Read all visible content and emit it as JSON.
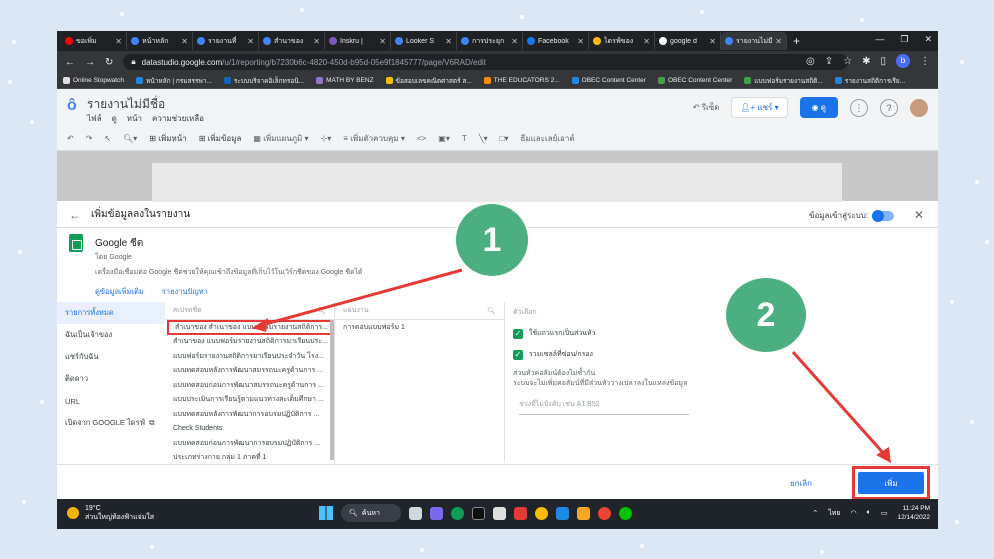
{
  "browser": {
    "tabs": [
      {
        "label": "ขอเพิ่ม",
        "color": "#ff0000",
        "active": false
      },
      {
        "label": "หน้าหลัก",
        "color": "#4285f4",
        "active": false
      },
      {
        "label": "รายงานที่",
        "color": "#4285f4",
        "active": false
      },
      {
        "label": "สำนาของ",
        "color": "#4285f4",
        "active": false
      },
      {
        "label": "Inskru |",
        "color": "#7e57c2",
        "active": false
      },
      {
        "label": "Looker S",
        "color": "#4285f4",
        "active": false
      },
      {
        "label": "การประยุก",
        "color": "#4285f4",
        "active": false
      },
      {
        "label": "Facebook",
        "color": "#1877f2",
        "active": false
      },
      {
        "label": "ไดรฟ์ของ",
        "color": "#fbbc04",
        "active": false
      },
      {
        "label": "google d",
        "color": "#ffffff",
        "active": false
      },
      {
        "label": "รายงานไม่มี",
        "color": "#4285f4",
        "active": true
      }
    ],
    "new_tab": "+",
    "url_host": "datastudio.google.com",
    "url_path": "/u/1/reporting/b7230b6c-4820-450d-b95d-05e9f1845777/page/V6RAD/edit",
    "profile_letter": "b",
    "bookmarks": [
      "Online Stopwatch",
      "หน้าหลัก | กรมสรรพา...",
      "ระบบบริจาคอิเล็กทรอนิ...",
      "MATH BY BENZ",
      "ข้อสอบเลขคณิตศาสตร์ ส...",
      "THE EDUCATORS 2...",
      "OBEC Content Center",
      "OBEC Content Center",
      "แบบฟอร์มรายงานสถิติ...",
      "รายงานสถิติการเรีย..."
    ]
  },
  "datastudio": {
    "title": "รายงานไม่มีชื่อ",
    "menu": [
      "ไฟล์",
      "ดู",
      "หน้า",
      "ความช่วยเหลือ"
    ],
    "reset": "รีเซ็ต",
    "share": "แชร์",
    "view": "ดู",
    "toolbar": {
      "add_page": "เพิ่มหน้า",
      "add_data": "เพิ่มข้อมูล",
      "add_chart": "เพิ่มแผนภูมิ",
      "add_control": "เพิ่มตัวควบคุม",
      "theme": "ธีมและเลย์เอาต์"
    }
  },
  "panel": {
    "title": "เพิ่มข้อมูลลงในรายงาน",
    "auto_load": "ข้อมูลเข้าสู่ระบบ:",
    "connector_name": "Google ชีต",
    "connector_by": "โดย Google",
    "connector_desc": "เครื่องมือเชื่อมต่อ Google ชีตช่วยให้คุณเข้าถึงข้อมูลที่เก็บไว้ในเวิร์กชีตของ Google ชีตได้",
    "links": [
      "ดูข้อมูลเพิ่มเติม",
      "รายงานปัญหา"
    ],
    "sidenav": [
      "รายการทั้งหมด",
      "ฉันเป็นเจ้าของ",
      "แชร์กับฉัน",
      "ติดดาว",
      "URL",
      "เปิดจาก GOOGLE ไดรฟ์"
    ],
    "spreadsheet_header": "สเปรดชีต",
    "spreadsheets": [
      "สำเนาของ สำเนาของ แบบฟอร์มรายงานสถิติการ...",
      "สำเนาของ แบบฟอร์มรายงานสถิติการมาเรียนประ...",
      "แบบฟอร์มรายงานสถิติการมาเรียนประจำวัน โรง...",
      "แบบทดสอบหลังการพัฒนาสมรรถนะครูด้านการ ...",
      "แบบทดสอบก่อนการพัฒนาสมรรถนะครูด้านการ ...",
      "แบบประเมินการเรียนรู้ตามแนวทางสะเต็มศึกษา ...",
      "แบบทดสอบหลังการพัฒนาการอบรมปฏิบัติการ ...",
      "Check Students",
      "แบบทดสอบก่อนการพัฒนาการอบรมปฏิบัติการ ...",
      "ประเภทร่างกาย กลุ่ม 1 ภาคที่ 1"
    ],
    "worksheet_header": "แผ่นงาน",
    "worksheets": [
      "การตอบแบบฟอร์ม 1"
    ],
    "options_header": "ตัวเลือก",
    "options": [
      "ใช้แถวแรกเป็นส่วนหัว",
      "รวมเซลล์ที่ซ่อน/กรอง"
    ],
    "options_note_1": "ส่วนหัวคอลัมน์ต้องไม่ซ้ำกัน",
    "options_note_2": "ระบบจะไม่เพิ่มคอลัมน์ที่มีส่วนหัวว่างเปล่าลงในแหล่งข้อมูล",
    "range_placeholder": "ช่วงที่ไม่บังคับ เช่น A1:B52",
    "cancel": "ยกเลิก",
    "add": "เพิ่ม"
  },
  "taskbar": {
    "temp": "19°C",
    "weather": "ส่วนใหญ่ท้องฟ้าแจ่มใส",
    "search": "ค้นหา",
    "lang": "ไทย",
    "time": "11:24 PM",
    "date": "12/14/2022"
  },
  "annotations": {
    "step1": "1",
    "step2": "2"
  }
}
